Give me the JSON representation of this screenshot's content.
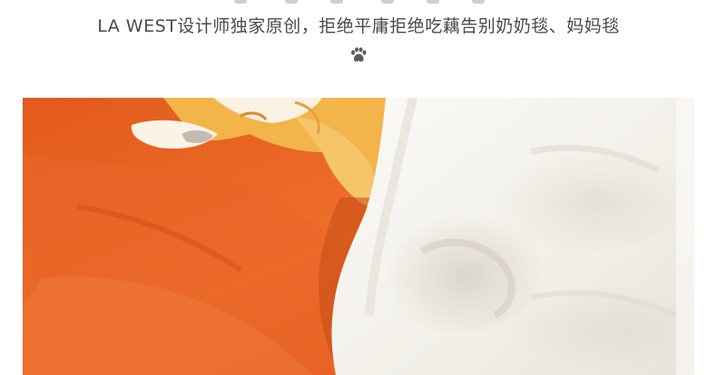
{
  "tagline": "LA WEST设计师独家原创，拒绝平庸拒绝吃藕告别奶奶毯、妈妈毯",
  "icons": {
    "paw": "paw-icon"
  },
  "colors": {
    "text": "#4a4a4a",
    "blanket_orange": "#e4591b",
    "fleece_white": "#f7f5f1",
    "pattern_yellow": "#f3b44a"
  }
}
